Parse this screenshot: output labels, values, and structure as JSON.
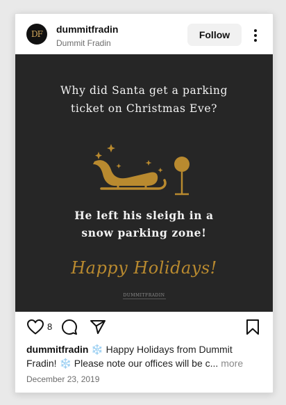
{
  "header": {
    "avatar_initials": "DF",
    "username": "dummitfradin",
    "display_name": "Dummit Fradin",
    "follow_label": "Follow"
  },
  "post_image": {
    "question_line1": "Why did Santa get a parking",
    "question_line2": "ticket on Christmas Eve?",
    "answer_line1": "He left his sleigh in a",
    "answer_line2": "snow parking zone!",
    "greeting": "Happy Holidays!",
    "wordmark": "DUMMITFRADIN",
    "colors": {
      "background": "#262626",
      "gold": "#b98a2f",
      "text": "#f3f3f3"
    }
  },
  "actions": {
    "like_count": "8",
    "icons": [
      "heart-icon",
      "comment-icon",
      "share-icon",
      "bookmark-icon"
    ]
  },
  "caption": {
    "username": "dummitfradin",
    "text": " ❄️ Happy Holidays from Dummit Fradin! ❄️ Please note our offices will be c...",
    "more_label": " more"
  },
  "date": "December 23, 2019"
}
